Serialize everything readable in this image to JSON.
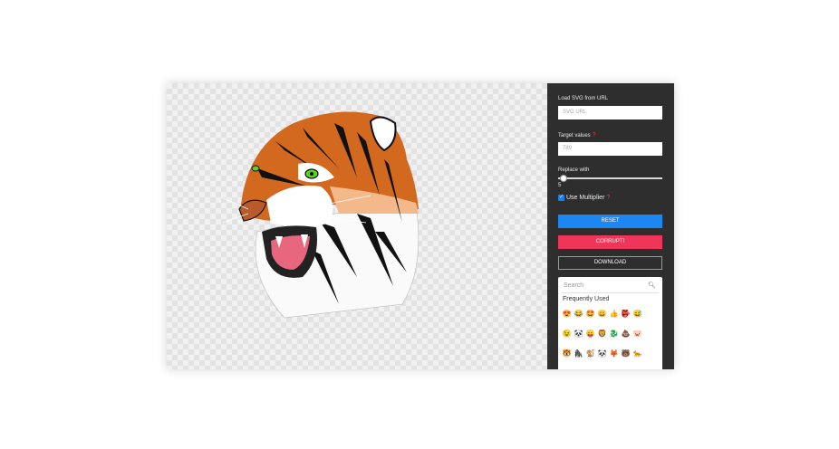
{
  "panel": {
    "load_label": "Load SVG from URL",
    "url_placeholder": "SVG URL",
    "target_label": "Target values",
    "help_mark": "?",
    "target_placeholder": "789",
    "replace_label": "Replace with",
    "replace_value": "5",
    "use_multiplier_label": "Use Multiplier",
    "use_multiplier_checked": true,
    "reset_label": "RESET",
    "corrupt_label": "CORRUPT!",
    "download_label": "DOWNLOAD",
    "colors": {
      "panel": "#2e2e2e",
      "reset": "#1c86f2",
      "corrupt": "#ef365a"
    }
  },
  "emoji": {
    "search_placeholder": "Search",
    "search_icon": "magnifier-icon",
    "section_title": "Frequently Used",
    "rows": [
      [
        "😍",
        "😂",
        "🤩",
        "😀",
        "👍",
        "👺",
        "😅"
      ],
      [
        "😉",
        "🐼",
        "😛",
        "🦁",
        "🐉",
        "💩",
        "🐷"
      ],
      [
        "🐯",
        "🦍",
        "🐒",
        "🐼",
        "🦊",
        "🐻",
        "🐆"
      ]
    ]
  }
}
